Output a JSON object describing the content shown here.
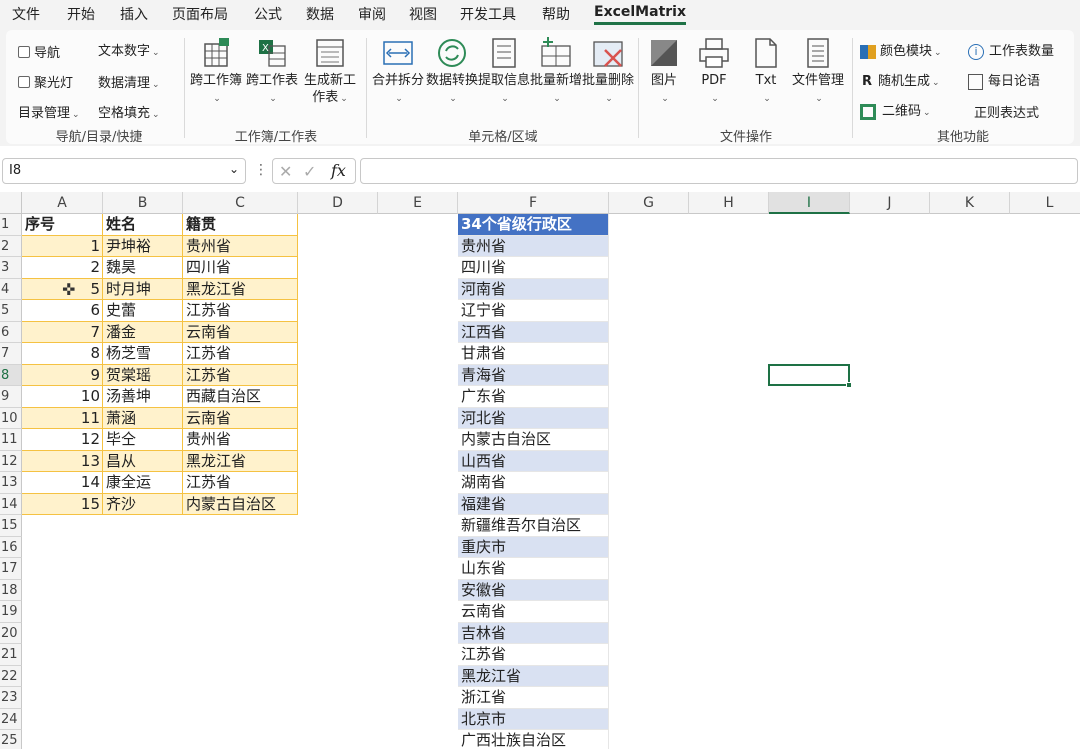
{
  "menu": [
    "文件",
    "开始",
    "插入",
    "页面布局",
    "公式",
    "数据",
    "审阅",
    "视图",
    "开发工具",
    "帮助",
    "ExcelMatrix"
  ],
  "ribbon": {
    "nav": {
      "toggle1": "导航",
      "toggle2": "聚光灯",
      "directory": "目录管理",
      "text_number": "文本数字",
      "data_clean": "数据清理",
      "blank_fill": "空格填充",
      "group": "导航/目录/快捷"
    },
    "workbook": {
      "cross_book": "跨工作簿",
      "cross_table": "跨工作表",
      "new_sheet": "生成新工作表",
      "group": "工作簿/工作表"
    },
    "cells": {
      "merge_split": "合并拆分",
      "data_convert": "数据转换",
      "extract": "提取信息",
      "batch_add": "批量新增",
      "batch_delete": "批量删除",
      "group": "单元格/区域"
    },
    "files": {
      "picture": "图片",
      "pdf": "PDF",
      "txt": "Txt",
      "file_manage": "文件管理",
      "group": "文件操作"
    },
    "other": {
      "color_mode": "颜色模块",
      "random_gen": "随机生成",
      "qrcode": "二维码",
      "sheet_count": "工作表数量",
      "daily_quote": "每日论语",
      "regex": "正则表达式",
      "group": "其他功能"
    }
  },
  "formula_bar": {
    "name_box": "I8",
    "formula": ""
  },
  "columns": [
    "A",
    "B",
    "C",
    "D",
    "E",
    "F",
    "G",
    "H",
    "I",
    "J",
    "K",
    "L"
  ],
  "selected_cell": "I8",
  "table": {
    "headers": [
      "序号",
      "姓名",
      "籍贯"
    ],
    "rows": [
      [
        "1",
        "尹坤裕",
        "贵州省"
      ],
      [
        "2",
        "魏昊",
        "四川省"
      ],
      [
        "5",
        "时月坤",
        "黑龙江省"
      ],
      [
        "6",
        "史蕾",
        "江苏省"
      ],
      [
        "7",
        "潘金",
        "云南省"
      ],
      [
        "8",
        "杨芝雪",
        "江苏省"
      ],
      [
        "9",
        "贺棠瑶",
        "江苏省"
      ],
      [
        "10",
        "汤善坤",
        "西藏自治区"
      ],
      [
        "11",
        "萧涵",
        "云南省"
      ],
      [
        "12",
        "毕仝",
        "贵州省"
      ],
      [
        "13",
        "昌从",
        "黑龙江省"
      ],
      [
        "14",
        "康全运",
        "江苏省"
      ],
      [
        "15",
        "齐沙",
        "内蒙古自治区"
      ]
    ]
  },
  "provinces": {
    "header": "34个省级行政区",
    "items": [
      "贵州省",
      "四川省",
      "河南省",
      "辽宁省",
      "江西省",
      "甘肃省",
      "青海省",
      "广东省",
      "河北省",
      "内蒙古自治区",
      "山西省",
      "湖南省",
      "福建省",
      "新疆维吾尔自治区",
      "重庆市",
      "山东省",
      "安徽省",
      "云南省",
      "吉林省",
      "江苏省",
      "黑龙江省",
      "浙江省",
      "北京市",
      "广西壮族自治区"
    ]
  },
  "colors": {
    "accent": "#1e7145",
    "table_highlight": "#fff2cc",
    "table_border": "#f5c242",
    "province_header": "#4472c4",
    "province_band": "#d9e1f2"
  }
}
